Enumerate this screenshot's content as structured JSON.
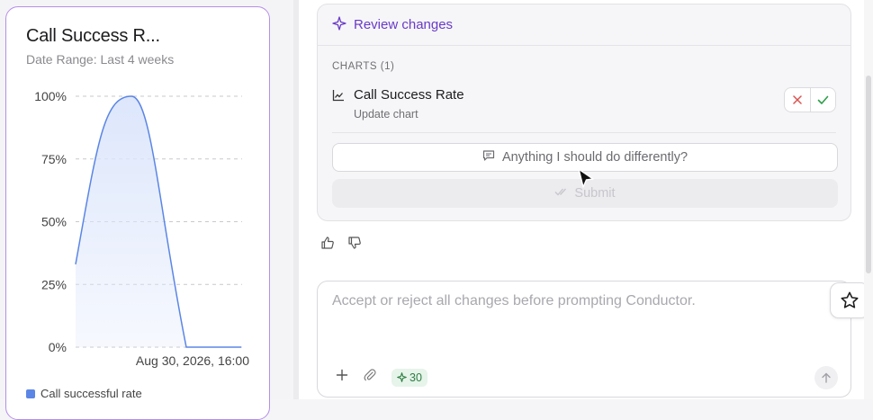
{
  "chart_card": {
    "title": "Call Success R...",
    "subtitle": "Date Range: Last 4 weeks",
    "legend_label": "Call successful rate"
  },
  "chart_data": {
    "type": "area",
    "title": "Call Success R...",
    "x_label_shown": "Aug 30, 2026, 16:00",
    "y_ticks": [
      "100%",
      "75%",
      "50%",
      "25%",
      "0%"
    ],
    "ylim": [
      0,
      100
    ],
    "grid": true,
    "series": [
      {
        "name": "Call successful rate",
        "values": [
          33,
          100,
          0,
          0
        ]
      }
    ],
    "accent_color": "#5b86e5",
    "fill_color": "#dbe5fb"
  },
  "review": {
    "header": "Review changes",
    "section_label": "CHARTS (1)",
    "item_title": "Call Success Rate",
    "item_subtitle": "Update chart",
    "feedback_placeholder": "Anything I should do differently?",
    "submit_label": "Submit"
  },
  "prompt": {
    "placeholder": "Accept or reject all changes before prompting Conductor.",
    "credits": "30"
  },
  "colors": {
    "accent_purple": "#6a3bc7",
    "accept_green": "#2e9e49",
    "reject_red": "#d9534f"
  }
}
